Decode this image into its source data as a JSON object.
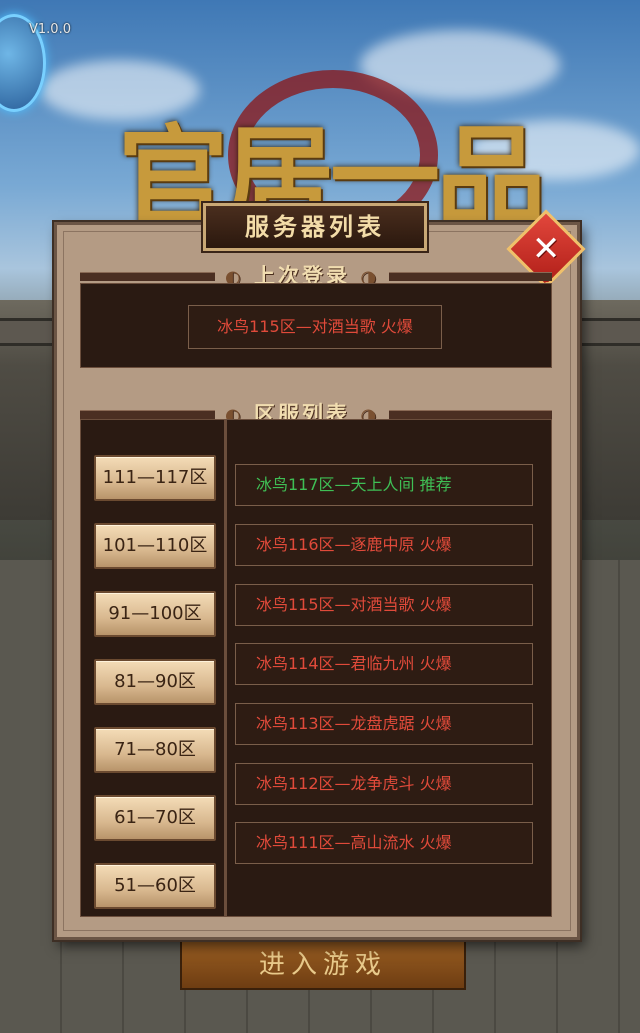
{
  "version": "V1.0.0",
  "logo_text": "官居一品",
  "dialog": {
    "title": "服务器列表",
    "close_label": "✕",
    "last_login_header": "上次登录",
    "server_list_header": "区服列表",
    "last_server": "冰鸟115区—对酒当歌  火爆"
  },
  "zone_tabs": [
    "111—117区",
    "101—110区",
    "91—100区",
    "81—90区",
    "71—80区",
    "61—70区",
    "51—60区"
  ],
  "servers": [
    {
      "label": "冰鸟117区—天上人间  推荐",
      "color": "#3fbf55"
    },
    {
      "label": "冰鸟116区—逐鹿中原  火爆",
      "color": "#e04a3a"
    },
    {
      "label": "冰鸟115区—对酒当歌  火爆",
      "color": "#e04a3a"
    },
    {
      "label": "冰鸟114区—君临九州  火爆",
      "color": "#e04a3a"
    },
    {
      "label": "冰鸟113区—龙盘虎踞  火爆",
      "color": "#e04a3a"
    },
    {
      "label": "冰鸟112区—龙争虎斗  火爆",
      "color": "#e04a3a"
    },
    {
      "label": "冰鸟111区—高山流水  火爆",
      "color": "#e04a3a"
    }
  ],
  "enter_button": "进入游戏"
}
